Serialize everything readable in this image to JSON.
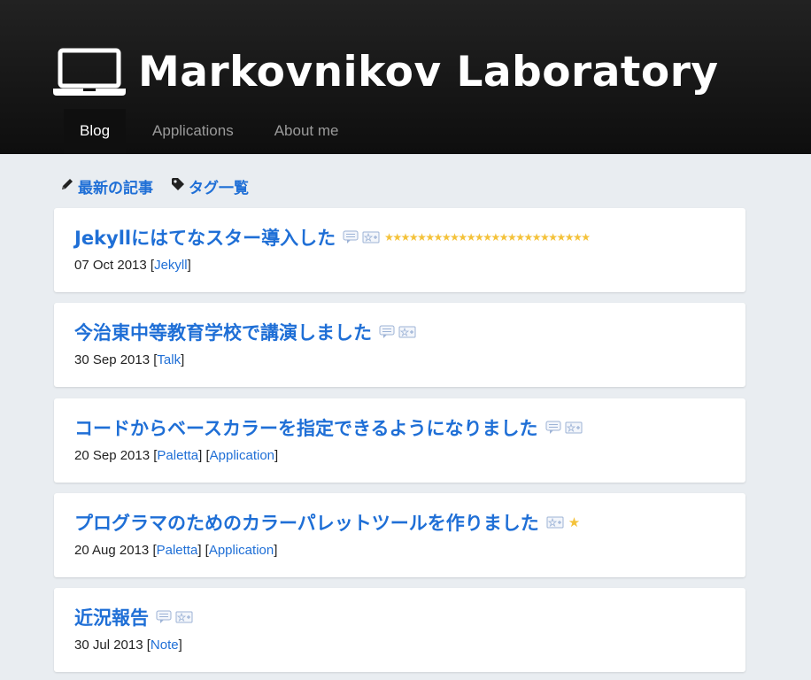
{
  "site": {
    "title": "Markovnikov Laboratory",
    "icon": "laptop-icon"
  },
  "nav": {
    "items": [
      {
        "label": "Blog",
        "active": true
      },
      {
        "label": "Applications",
        "active": false
      },
      {
        "label": "About me",
        "active": false
      }
    ]
  },
  "subnav": {
    "latest": "最新の記事",
    "tags": "タグ一覧"
  },
  "posts": [
    {
      "title": "Jekyllにはてなスター導入した",
      "date": "07 Oct 2013",
      "tags": [
        "Jekyll"
      ],
      "stars": "★★★★★★★★★★★★★★★★★★★★★★★★★"
    },
    {
      "title": "今治東中等教育学校で講演しました",
      "date": "30 Sep 2013",
      "tags": [
        "Talk"
      ],
      "stars": ""
    },
    {
      "title": "コードからベースカラーを指定できるようになりました",
      "date": "20 Sep 2013",
      "tags": [
        "Paletta",
        "Application"
      ],
      "stars": ""
    },
    {
      "title": "プログラマのためのカラーパレットツールを作りました",
      "date": "20 Aug 2013",
      "tags": [
        "Paletta",
        "Application"
      ],
      "stars": "★"
    },
    {
      "title": "近況報告",
      "date": "30 Jul 2013",
      "tags": [
        "Note"
      ],
      "stars": ""
    }
  ],
  "punct": {
    "open": "[",
    "close": "]"
  },
  "colors": {
    "link": "#1f6fd6",
    "star": "#f4c23a",
    "header": "#111111",
    "background": "#e9edf1"
  }
}
